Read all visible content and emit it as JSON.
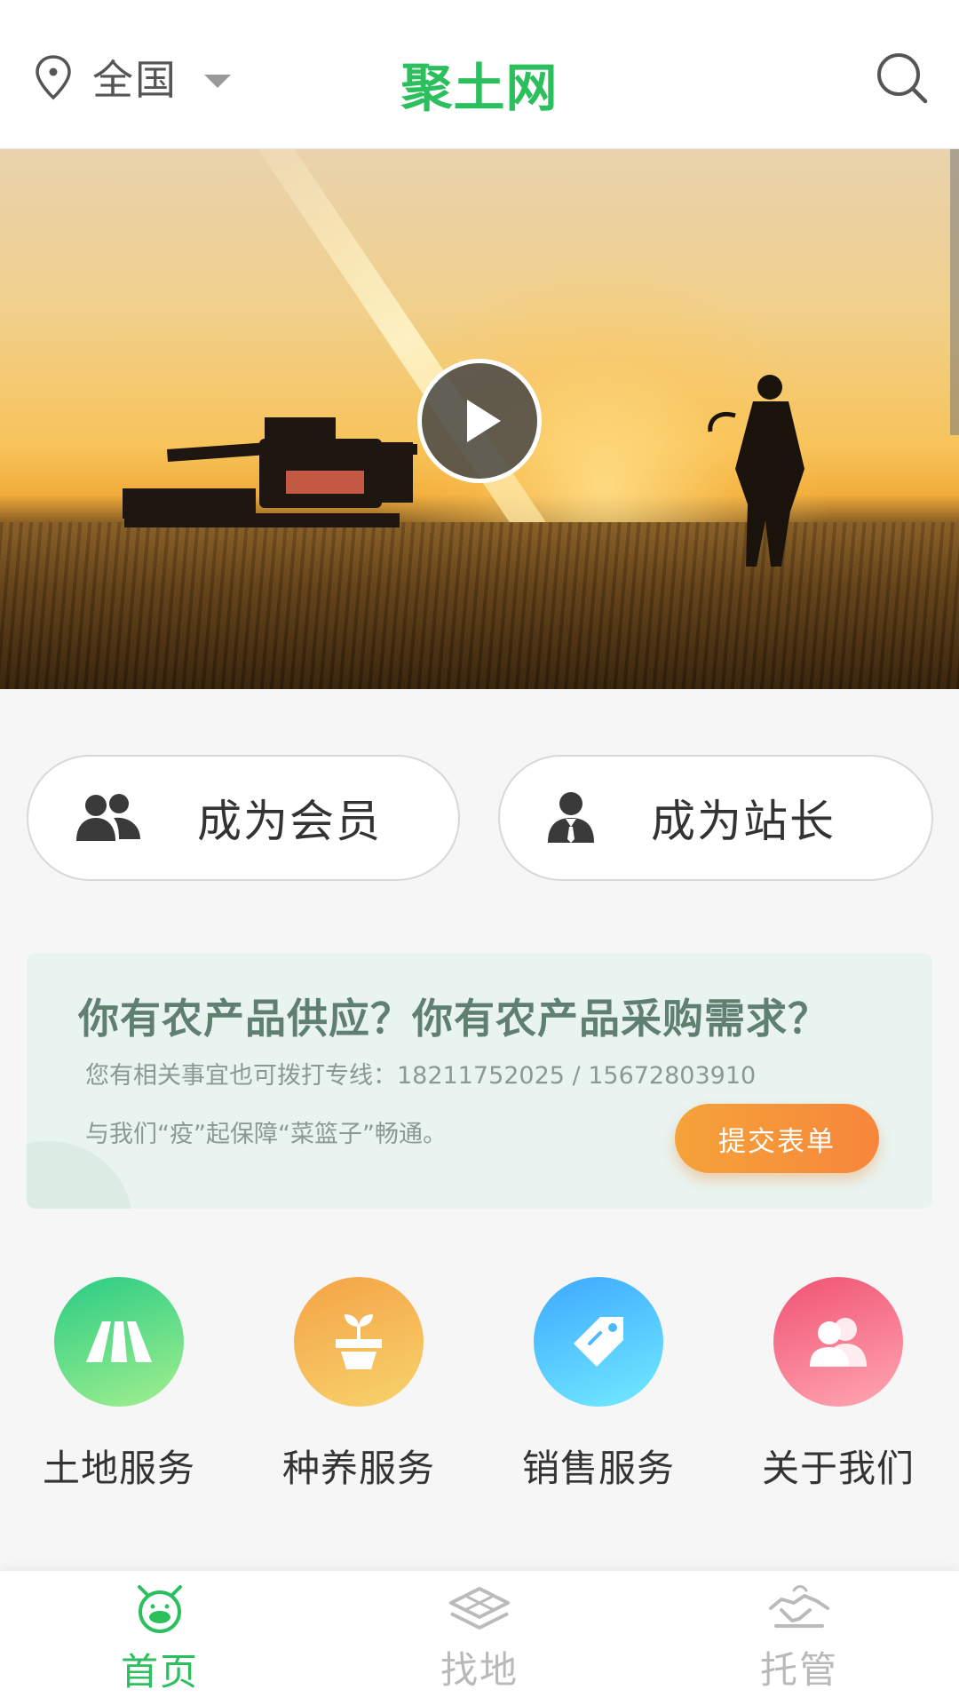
{
  "header": {
    "location": "全国",
    "brand": "聚土网",
    "icons": {
      "location": "location-pin-icon",
      "dropdown": "caret-down-icon",
      "search": "search-icon"
    },
    "brand_color": "#2bbf5e"
  },
  "hero": {
    "type": "video",
    "play_icon": "play-icon"
  },
  "roles": [
    {
      "label": "成为会员",
      "icon": "members-group-icon"
    },
    {
      "label": "成为站长",
      "icon": "stationmaster-person-icon"
    }
  ],
  "promo": {
    "title": "你有农产品供应？你有农产品采购需求？",
    "phone_line": "您有相关事宜也可拨打专线：18211752025 / 15672803910",
    "slogan": "与我们“疫”起保障“菜篮子”畅通。",
    "button": "提交表单",
    "button_color": "#f7863b"
  },
  "services": [
    {
      "label": "土地服务",
      "icon": "land-road-icon",
      "color": "#29cc84"
    },
    {
      "label": "种养服务",
      "icon": "sprout-pot-icon",
      "color": "#f4a346"
    },
    {
      "label": "销售服务",
      "icon": "price-tag-icon",
      "color": "#3ea8ff"
    },
    {
      "label": "关于我们",
      "icon": "users-icon",
      "color": "#f05273"
    }
  ],
  "tabbar": {
    "items": [
      {
        "label": "首页",
        "icon": "home-mascot-icon",
        "active": true
      },
      {
        "label": "找地",
        "icon": "land-plot-icon",
        "active": false
      },
      {
        "label": "托管",
        "icon": "handshake-icon",
        "active": false
      }
    ],
    "active_color": "#2bbf5e",
    "inactive_color": "#b9b9b9"
  }
}
